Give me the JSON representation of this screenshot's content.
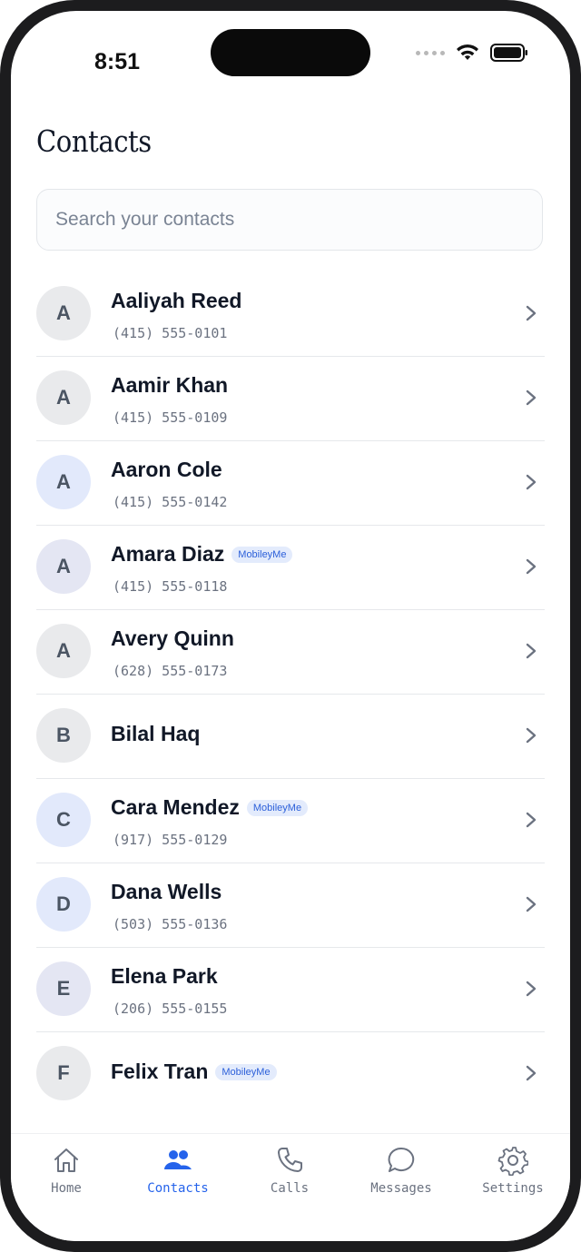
{
  "status_bar": {
    "time": "8:51"
  },
  "header": {
    "title": "Contacts"
  },
  "search": {
    "placeholder": "Search your contacts",
    "value": ""
  },
  "contacts": [
    {
      "initial": "A",
      "name": "Aaliyah Reed",
      "phone": "(415) 555-0101",
      "avatar_color": "#e9eaec"
    },
    {
      "initial": "A",
      "name": "Aamir Khan",
      "phone": "(415) 555-0109",
      "avatar_color": "#e9eaec"
    },
    {
      "initial": "A",
      "name": "Aaron Cole",
      "phone": "(415) 555-0142",
      "avatar_color": "#e2e9fb"
    },
    {
      "initial": "A",
      "name": "Amara Diaz",
      "badge": "MobileyMe",
      "phone": "(415) 555-0118",
      "avatar_color": "#e4e6f3"
    },
    {
      "initial": "A",
      "name": "Avery Quinn",
      "phone": "(628) 555-0173",
      "avatar_color": "#e9eaec"
    },
    {
      "initial": "B",
      "name": "Bilal Haq",
      "avatar_color": "#e9eaec"
    },
    {
      "initial": "C",
      "name": "Cara Mendez",
      "badge": "MobileyMe",
      "phone": "(917) 555-0129",
      "avatar_color": "#e2e9fb"
    },
    {
      "initial": "D",
      "name": "Dana Wells",
      "phone": "(503) 555-0136",
      "avatar_color": "#e2e9fb"
    },
    {
      "initial": "E",
      "name": "Elena Park",
      "phone": "(206) 555-0155",
      "avatar_color": "#e4e6f3"
    },
    {
      "initial": "F",
      "name": "Felix Tran",
      "badge": "MobileyMe",
      "avatar_color": "#e9eaec"
    }
  ],
  "tabbar": {
    "items": [
      {
        "label": "Home",
        "icon": "home-icon",
        "active": false
      },
      {
        "label": "Contacts",
        "icon": "contacts-icon",
        "active": true
      },
      {
        "label": "Calls",
        "icon": "phone-icon",
        "active": false
      },
      {
        "label": "Messages",
        "icon": "chat-bubble-icon",
        "active": false
      },
      {
        "label": "Settings",
        "icon": "gear-icon",
        "active": false
      }
    ]
  },
  "colors": {
    "accent": "#2563eb",
    "text": "#111827",
    "muted": "#6b7280"
  }
}
